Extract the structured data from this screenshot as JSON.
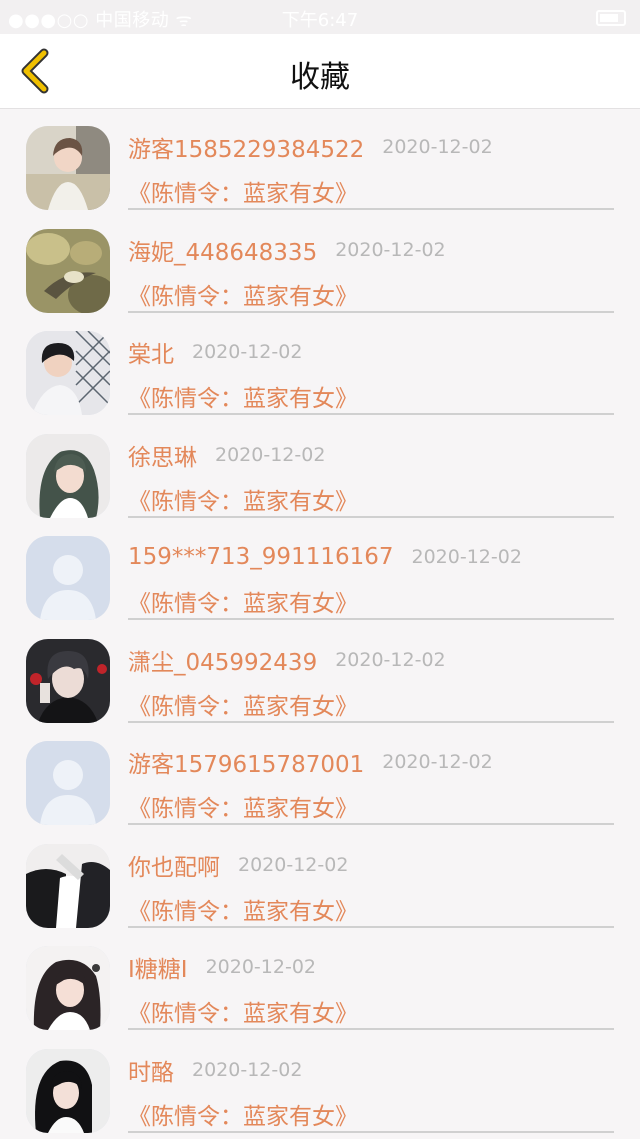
{
  "status_bar": {
    "carrier": "●●●○○ 中国移动 ᯤ",
    "time": "下午6:47"
  },
  "header": {
    "title": "收藏",
    "back_icon": "chevron-left-icon",
    "accent_color": "#f0c000"
  },
  "favorites": [
    {
      "user": "游客1585229384522",
      "date": "2020-12-02",
      "book": "《陈情令：蓝家有女》",
      "avatar": "photo-boy"
    },
    {
      "user": "海妮_448648335",
      "date": "2020-12-02",
      "book": "《陈情令：蓝家有女》",
      "avatar": "photo-bird"
    },
    {
      "user": "棠北",
      "date": "2020-12-02",
      "book": "《陈情令：蓝家有女》",
      "avatar": "photo-boy-fence"
    },
    {
      "user": "徐思琳",
      "date": "2020-12-02",
      "book": "《陈情令：蓝家有女》",
      "avatar": "photo-girl-green"
    },
    {
      "user": "159***713_991116167",
      "date": "2020-12-02",
      "book": "《陈情令：蓝家有女》",
      "avatar": "default-avatar"
    },
    {
      "user": "潇尘_045992439",
      "date": "2020-12-02",
      "book": "《陈情令：蓝家有女》",
      "avatar": "illustration-dark"
    },
    {
      "user": "游客1579615787001",
      "date": "2020-12-02",
      "book": "《陈情令：蓝家有女》",
      "avatar": "default-avatar"
    },
    {
      "user": "你也配啊",
      "date": "2020-12-02",
      "book": "《陈情令：蓝家有女》",
      "avatar": "illustration-suit"
    },
    {
      "user": "I糖糖I",
      "date": "2020-12-02",
      "book": "《陈情令：蓝家有女》",
      "avatar": "photo-girl"
    },
    {
      "user": "时酪",
      "date": "2020-12-02",
      "book": "《陈情令：蓝家有女》",
      "avatar": "photo-girl-dark-hair"
    }
  ]
}
